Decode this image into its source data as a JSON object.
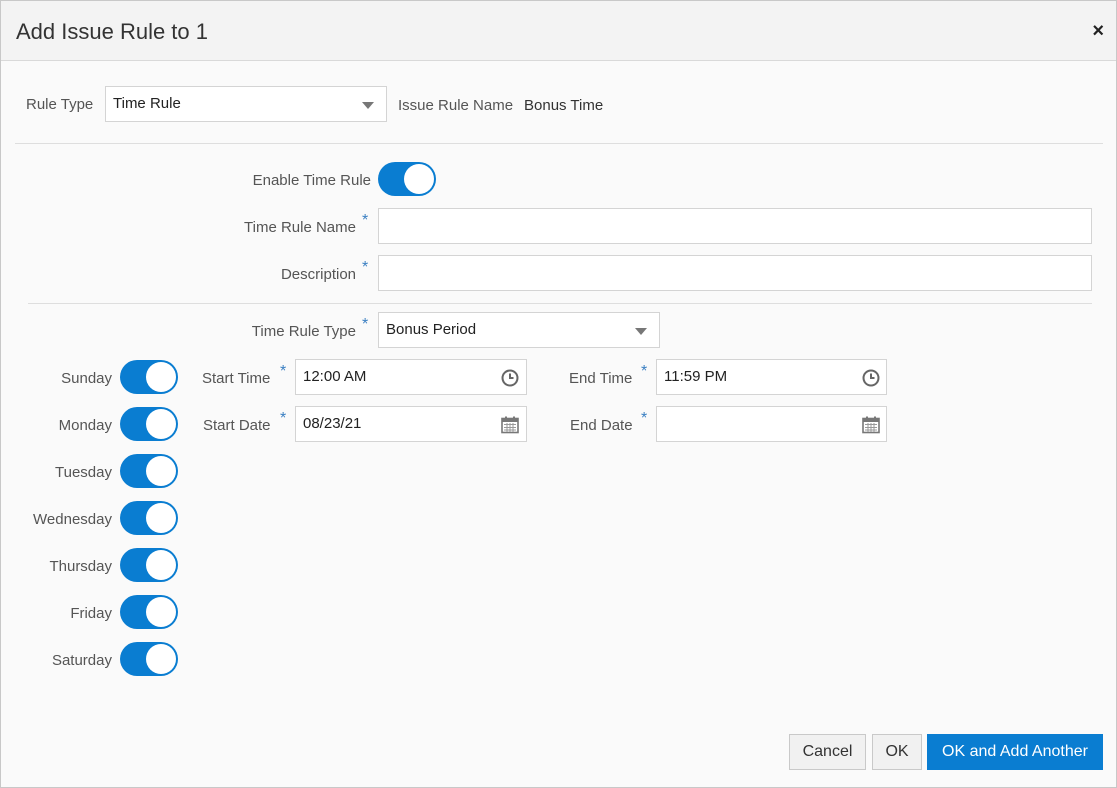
{
  "dialog": {
    "title": "Add Issue Rule to 1",
    "close_label": "×"
  },
  "top_row": {
    "rule_type_label": "Rule Type",
    "rule_type_value": "Time Rule",
    "issue_rule_name_label": "Issue Rule Name",
    "issue_rule_name_value": "Bonus Time"
  },
  "form": {
    "enable_time_rule_label": "Enable Time Rule",
    "enable_time_rule_on": true,
    "time_rule_name_label": "Time Rule Name",
    "time_rule_name_value": "",
    "description_label": "Description",
    "description_value": "",
    "time_rule_type_label": "Time Rule Type",
    "time_rule_type_value": "Bonus Period",
    "required_mark": "*"
  },
  "days": [
    {
      "label": "Sunday",
      "on": true
    },
    {
      "label": "Monday",
      "on": true
    },
    {
      "label": "Tuesday",
      "on": true
    },
    {
      "label": "Wednesday",
      "on": true
    },
    {
      "label": "Thursday",
      "on": true
    },
    {
      "label": "Friday",
      "on": true
    },
    {
      "label": "Saturday",
      "on": true
    }
  ],
  "schedule": {
    "start_time_label": "Start Time",
    "start_time_value": "12:00 AM",
    "end_time_label": "End Time",
    "end_time_value": "11:59 PM",
    "start_date_label": "Start Date",
    "start_date_value": "08/23/21",
    "end_date_label": "End Date",
    "end_date_value": ""
  },
  "footer": {
    "cancel_label": "Cancel",
    "ok_label": "OK",
    "ok_add_another_label": "OK and Add Another"
  },
  "colors": {
    "accent": "#0a7dd1",
    "required": "#3a7fc2"
  },
  "icons": {
    "dropdown": "chevron-down-icon",
    "time": "clock-icon",
    "date": "calendar-icon",
    "close": "close-icon"
  }
}
